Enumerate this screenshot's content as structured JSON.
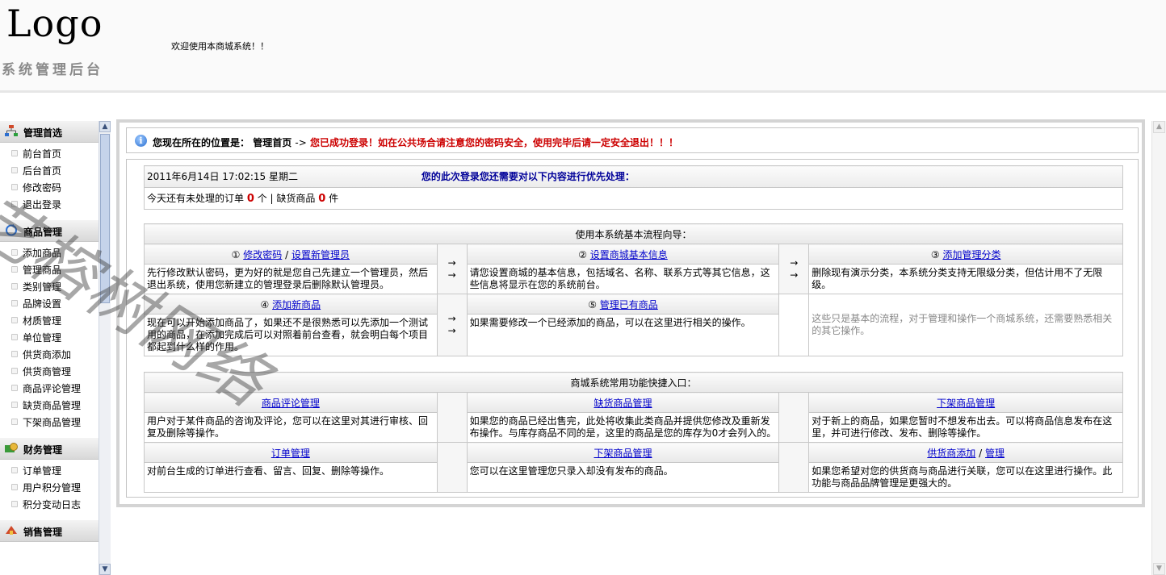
{
  "header": {
    "logo": "Logo",
    "subtitle": "系统管理后台",
    "welcome": "欢迎使用本商城系统！！"
  },
  "sidebar": {
    "groups": [
      {
        "title": "管理首选",
        "icon": "org-chart-icon",
        "items": [
          "前台首页",
          "后台首页",
          "修改密码",
          "退出登录"
        ]
      },
      {
        "title": "商品管理",
        "icon": "refresh-icon",
        "items": [
          "添加商品",
          "管理商品",
          "类别管理",
          "品牌设置",
          "材质管理",
          "单位管理",
          "供货商添加",
          "供货商管理",
          "商品评论管理",
          "缺货商品管理",
          "下架商品管理"
        ]
      },
      {
        "title": "财务管理",
        "icon": "money-icon",
        "items": [
          "订单管理",
          "用户积分管理",
          "积分变动日志"
        ]
      },
      {
        "title": "销售管理",
        "icon": "sales-icon",
        "items": []
      }
    ]
  },
  "location": {
    "label": "您现在所在的位置是：",
    "page": "管理首页",
    "arrow": "->",
    "notice": "您已成功登录！如在公共场合请注意您的密码安全，使用完毕后请一定安全退出！！！"
  },
  "status": {
    "datetime": "2011年6月14日  17:02:15 星期二",
    "priority": "您的此次登录您还需要对以下内容进行优先处理：",
    "pending_prefix": "今天还有未处理的订单",
    "pending_orders": "0",
    "orders_unit": "个 | 缺货商品",
    "out_of_stock": "0",
    "stock_unit": "件"
  },
  "guide": {
    "title": "使用本系统基本流程向导：",
    "arrows": "→",
    "step1": {
      "num": "①",
      "link1": "修改密码",
      "sep": "/",
      "link2": "设置新管理员",
      "desc": "先行修改默认密码，更为好的就是您自己先建立一个管理员，然后退出系统，使用您新建立的管理登录后删除默认管理员。"
    },
    "step2": {
      "num": "②",
      "link": "设置商城基本信息",
      "desc": "请您设置商城的基本信息，包括域名、名称、联系方式等其它信息，这些信息将显示在您的系统前台。"
    },
    "step3": {
      "num": "③",
      "link": "添加管理分类",
      "desc": "删除现有演示分类，本系统分类支持无限级分类，但估计用不了无限级。"
    },
    "step4": {
      "num": "④",
      "link": "添加新商品",
      "desc": "现在可以开始添加商品了，如果还不是很熟悉可以先添加一个测试用的商品，在添加完成后可以对照着前台查看，就会明白每个项目都起到什么样的作用。"
    },
    "step5": {
      "num": "⑤",
      "link": "管理已有商品",
      "desc": "如果需要修改一个已经添加的商品，可以在这里进行相关的操作。"
    },
    "extra": "这些只是基本的流程，对于管理和操作一个商城系统，还需要熟悉相关的其它操作。"
  },
  "shortcuts": {
    "title": "商城系统常用功能快捷入口：",
    "items": [
      {
        "link": "商品评论管理",
        "desc": "用户对于某件商品的咨询及评论，您可以在这里对其进行审核、回复及删除等操作。"
      },
      {
        "link": "缺货商品管理",
        "desc": "如果您的商品已经出售完，此处将收集此类商品并提供您修改及重新发布操作。与库存商品不同的是，这里的商品是您的库存为0才会列入的。"
      },
      {
        "link": "下架商品管理",
        "desc": "对于新上的商品，如果您暂时不想发布出去。可以将商品信息发布在这里，并可进行修改、发布、删除等操作。"
      },
      {
        "link": "订单管理",
        "desc": "对前台生成的订单进行查看、留言、回复、删除等操作。"
      },
      {
        "link": "下架商品管理",
        "desc": "您可以在这里管理您只录入却没有发布的商品。"
      },
      {
        "link": "供货商添加",
        "sep": "/",
        "link2": "管理",
        "desc": "如果您希望对您的供货商与商品进行关联，您可以在这里进行操作。此功能与商品品牌管理是更强大的。"
      }
    ]
  },
  "watermark": "艺榕树网络",
  "scroll": {
    "up": "▲",
    "down": "▼"
  }
}
